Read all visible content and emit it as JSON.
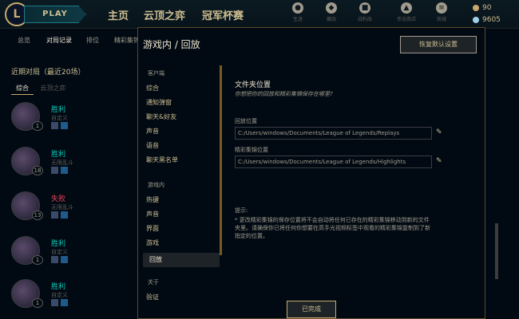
{
  "topbar": {
    "logo": "L",
    "play": "PLAY",
    "nav": [
      "主页",
      "云顶之弈",
      "冠军杯赛"
    ],
    "icons": [
      {
        "name": "profile-icon",
        "glyph": "●",
        "label": "生涯"
      },
      {
        "name": "collection-icon",
        "glyph": "◆",
        "label": "藏品"
      },
      {
        "name": "loot-icon",
        "glyph": "■",
        "label": "战利品"
      },
      {
        "name": "tft-pass-icon",
        "glyph": "▲",
        "label": "幸运商店"
      },
      {
        "name": "store-icon",
        "glyph": "≡",
        "label": "商城"
      }
    ],
    "currency": [
      {
        "name": "blue-essence-icon",
        "color": "#c8aa6e",
        "value": "90"
      },
      {
        "name": "rp-icon",
        "color": "#a0d0e8",
        "value": "9605"
      }
    ]
  },
  "subnav": [
    "总览",
    "对局记录",
    "排位",
    "精彩集锦"
  ],
  "sidebar": {
    "heading": "近期对局（最近20场）",
    "tabs": [
      "综合",
      "云顶之弈"
    ],
    "matches": [
      {
        "result": "胜利",
        "mode": "自定义",
        "level": "1",
        "win": true
      },
      {
        "result": "胜利",
        "mode": "无限乱斗",
        "level": "18",
        "win": true
      },
      {
        "result": "失败",
        "mode": "无限乱斗",
        "level": "13",
        "win": false
      },
      {
        "result": "胜利",
        "mode": "自定义",
        "level": "1",
        "win": true
      },
      {
        "result": "胜利",
        "mode": "自定义",
        "level": "1",
        "win": true
      }
    ]
  },
  "dialog": {
    "breadcrumb": "游戏内  /  回放",
    "reset_label": "恢复默认设置",
    "done_label": "已完成",
    "menu": {
      "client_header": "客户端",
      "client_items": [
        "综合",
        "通知弹窗",
        "聊天&好友",
        "声音",
        "语音",
        "聊天黑名单"
      ],
      "game_header": "游戏内",
      "game_items": [
        "热键",
        "声音",
        "界面",
        "游戏",
        "回放"
      ],
      "about_header": "关于",
      "about_items": [
        "验证"
      ],
      "active": "回放"
    },
    "content": {
      "title": "文件夹位置",
      "subtitle": "你想把你的回放和精彩集锦保存在哪里?",
      "replay_label": "回放位置",
      "replay_path": "C:/Users/windows/Documents/League of Legends/Replays",
      "highlight_label": "精彩集锦位置",
      "highlight_path": "C:/Users/windows/Documents/League of Legends/Highlights",
      "hint_label": "提示:",
      "hint_text": "* 更改精彩集锦的保存位置将不会自动将任何已存在的精彩集锦移动到新的文件夹里。请确保你已将任何你想要在高手光视频标签中观看的精彩集锦复制到了新指定的位置。"
    }
  },
  "colors": {
    "gold": "#c8aa6e",
    "win": "#0ac8b9",
    "loss": "#e84057"
  }
}
